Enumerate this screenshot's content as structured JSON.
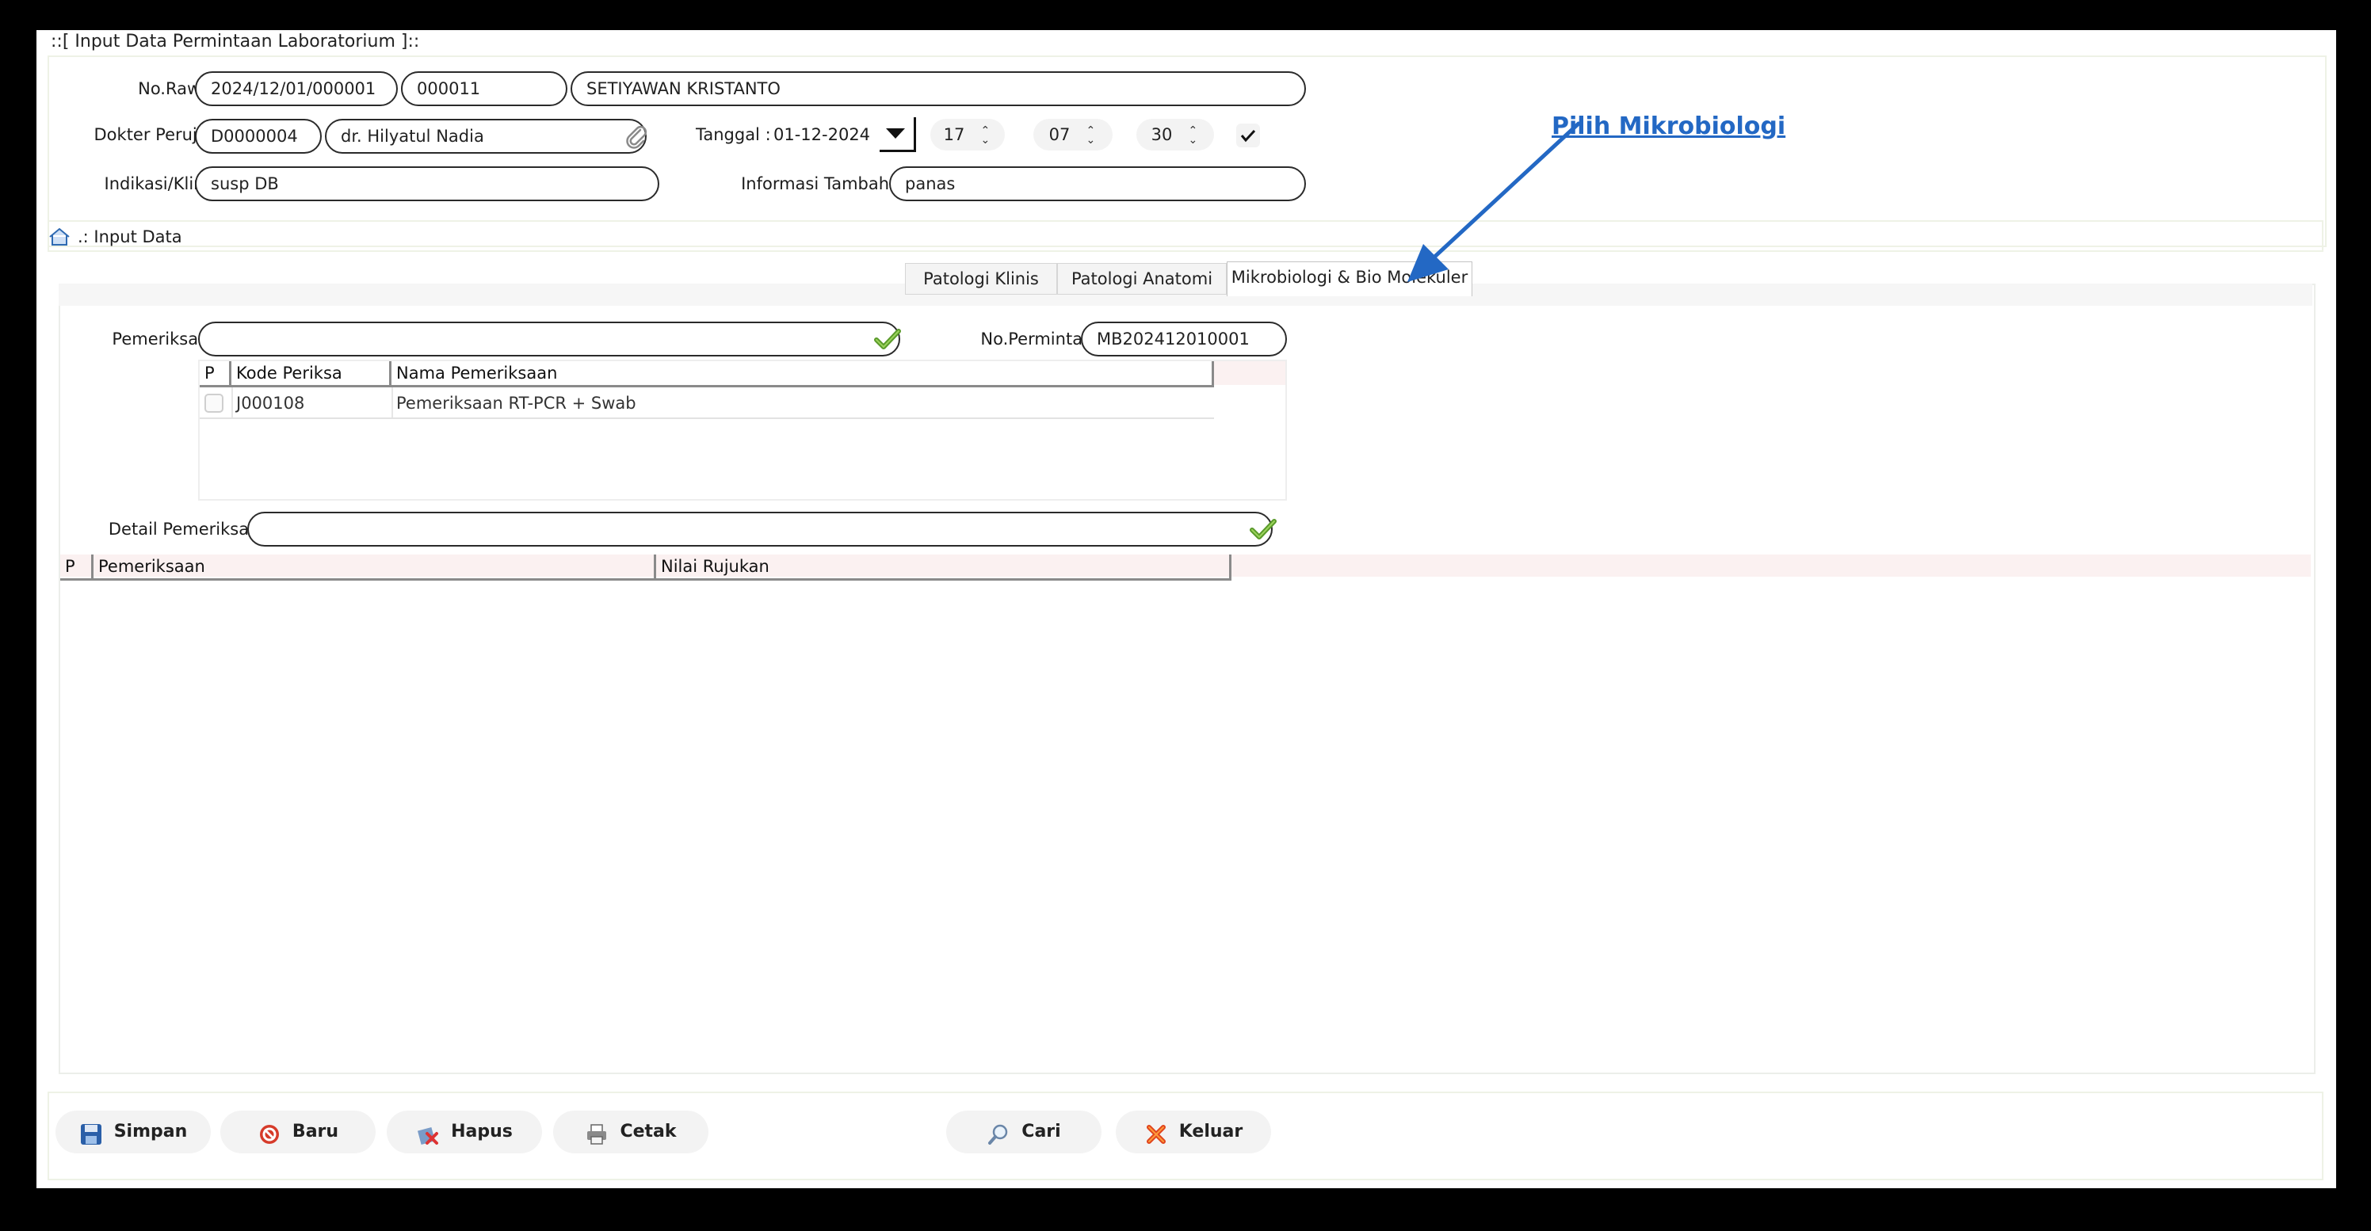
{
  "window": {
    "title": "::[ Input Data Permintaan Laboratorium ]::"
  },
  "form": {
    "no_rawat_label": "No.Rawat :",
    "no_rawat": "2024/12/01/000001",
    "no_rm": "000011",
    "nama_pasien": "SETIYAWAN KRISTANTO",
    "dokter_label": "Dokter Perujuk :",
    "kode_dokter": "D0000004",
    "nama_dokter": "dr. Hilyatul Nadia",
    "tanggal_label": "Tanggal :",
    "tanggal": "01-12-2024",
    "jam": "17",
    "menit": "07",
    "detik": "30",
    "indikasi_label": "Indikasi/Klinis :",
    "indikasi": "susp DB",
    "info_label": "Informasi Tambahan :",
    "info": "panas"
  },
  "section": {
    "input_data_label": ".: Input Data"
  },
  "tabs": [
    {
      "label": "Patologi Klinis"
    },
    {
      "label": "Patologi Anatomi"
    },
    {
      "label": "Mikrobiologi & Bio Molekuler"
    }
  ],
  "active_tab": "Mikrobiologi & Bio Molekuler",
  "pemeriksaan": {
    "label": "Pemeriksaan :",
    "value": "",
    "no_permintaan_label": "No.Permintaan :",
    "no_permintaan": "MB202412010001",
    "columns": [
      "P",
      "Kode Periksa",
      "Nama Pemeriksaan"
    ],
    "rows": [
      {
        "checked": false,
        "kode": "J000108",
        "nama": "Pemeriksaan RT-PCR + Swab"
      }
    ]
  },
  "detail": {
    "label": "Detail Pemeriksaan :",
    "value": "",
    "columns": [
      "P",
      "Pemeriksaan",
      "Nilai Rujukan"
    ]
  },
  "buttons": {
    "simpan": "Simpan",
    "baru": "Baru",
    "hapus": "Hapus",
    "cetak": "Cetak",
    "cari": "Cari",
    "keluar": "Keluar"
  },
  "annotation": {
    "text": "Pilih Mikrobiologi",
    "color": "#2368c4"
  },
  "colors": {
    "accent_green": "#5a9a2a",
    "annotation_blue": "#2368c4"
  }
}
